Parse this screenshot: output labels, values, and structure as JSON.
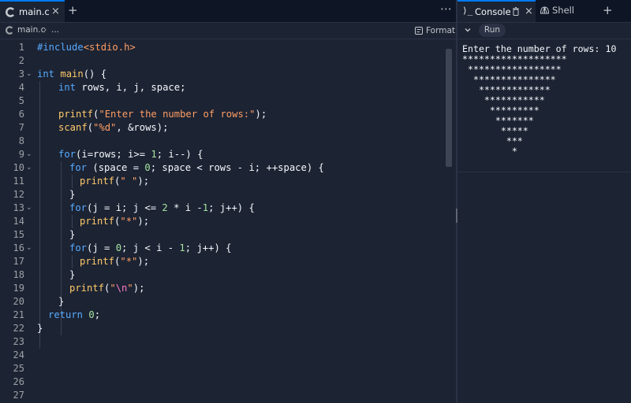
{
  "colors": {
    "background": "#1c2333",
    "tabbar": "#0e1525",
    "accent": "#0079f2",
    "keyword": "#57abff",
    "function": "#ffcb6b",
    "string": "#ff9e64",
    "number": "#a6e3a1"
  },
  "editor": {
    "tab": {
      "icon": "c-language-icon",
      "label": "main.c",
      "close": "×"
    },
    "add_tab": "+",
    "more": "⋯",
    "breadcrumb": {
      "file": "main.c",
      "separator": "›",
      "more": "..."
    },
    "format_label": "Format",
    "line_numbers": [
      "1",
      "2",
      "3",
      "4",
      "5",
      "6",
      "7",
      "8",
      "9",
      "10",
      "11",
      "12",
      "13",
      "14",
      "15",
      "16",
      "17",
      "18",
      "19",
      "20",
      "21",
      "22",
      "23",
      "24",
      "25",
      "26",
      "27"
    ]
  },
  "code": {
    "l1_a": "#include",
    "l1_b": "<stdio.h>",
    "l3_a": "int",
    "l3_b": " main",
    "l3_c": "() {",
    "l4_a": "int",
    "l4_b": " rows, i, j, space;",
    "l6_a": "printf",
    "l6_b": "(",
    "l6_c": "\"Enter the number of rows:\"",
    "l6_d": ");",
    "l7_a": "scanf",
    "l7_b": "(",
    "l7_c": "\"%d\"",
    "l7_d": ", &rows);",
    "l9_a": "for",
    "l9_b": "(i=rows; i>= ",
    "l9_c": "1",
    "l9_d": "; i--) {",
    "l10_a": "for",
    "l10_b": " (space = ",
    "l10_c": "0",
    "l10_d": "; space < rows - i; ++space) {",
    "l11_a": "printf",
    "l11_b": "(",
    "l11_c": "\" \"",
    "l11_d": ");",
    "l12": "}",
    "l13_a": "for",
    "l13_b": "(j = i; j <= ",
    "l13_c": "2",
    "l13_d": " * i -",
    "l13_e": "1",
    "l13_f": "; j++) {",
    "l14_a": "printf",
    "l14_b": "(",
    "l14_c": "\"*\"",
    "l14_d": ");",
    "l15": "}",
    "l16_a": "for",
    "l16_b": "(j = ",
    "l16_c": "0",
    "l16_d": "; j < i - ",
    "l16_e": "1",
    "l16_f": "; j++) {",
    "l17_a": "printf",
    "l17_b": "(",
    "l17_c": "\"*\"",
    "l17_d": ");",
    "l18": "}",
    "l19_a": "printf",
    "l19_b": "(",
    "l19_c": "\"",
    "l19_d": "\\n",
    "l19_e": "\"",
    "l19_f": ");",
    "l20": "}",
    "l21_a": "return",
    "l21_b": " ",
    "l21_c": "0",
    "l21_d": ";",
    "l22": "}"
  },
  "console": {
    "tab": {
      "icon": "terminal-prompt-icon",
      "prompt_glyph": "⟩_",
      "label": "Console",
      "close": "×"
    },
    "shell_tab": {
      "icon": "shell-icon",
      "label": "Shell"
    },
    "add_tab": "+",
    "run_label": "Run",
    "output": [
      "Enter the number of rows: 10",
      "*******************",
      " *****************",
      "  ***************",
      "   *************",
      "    ***********",
      "     *********",
      "      *******",
      "       *****",
      "        ***",
      "         *"
    ]
  }
}
